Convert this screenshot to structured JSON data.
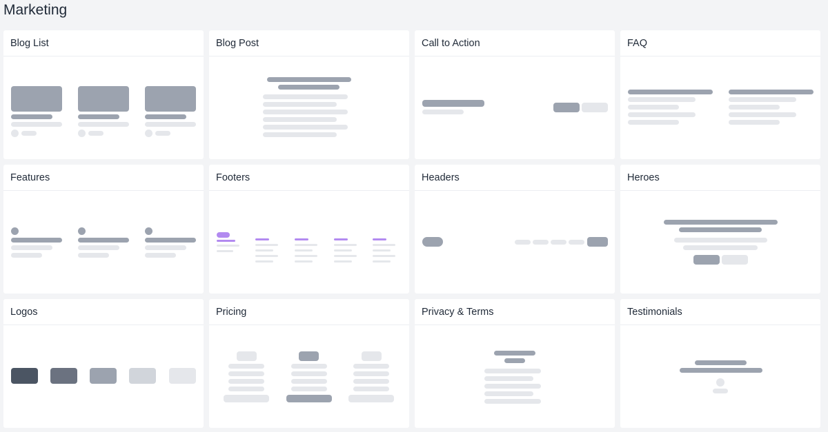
{
  "page": {
    "title": "Marketing"
  },
  "cards": [
    {
      "title": "Blog List"
    },
    {
      "title": "Blog Post"
    },
    {
      "title": "Call to Action"
    },
    {
      "title": "FAQ"
    },
    {
      "title": "Features"
    },
    {
      "title": "Footers"
    },
    {
      "title": "Headers"
    },
    {
      "title": "Heroes"
    },
    {
      "title": "Logos"
    },
    {
      "title": "Pricing"
    },
    {
      "title": "Privacy & Terms"
    },
    {
      "title": "Testimonials"
    }
  ],
  "colors": {
    "background": "#f3f4f6",
    "card": "#ffffff",
    "skeleton_dark": "#9ca3af",
    "skeleton_light": "#e5e7eb",
    "accent_purple": "#b28af0",
    "logo_shades": [
      "#4b5563",
      "#6b7280",
      "#9ca3af",
      "#d1d5db",
      "#e5e7eb"
    ]
  }
}
